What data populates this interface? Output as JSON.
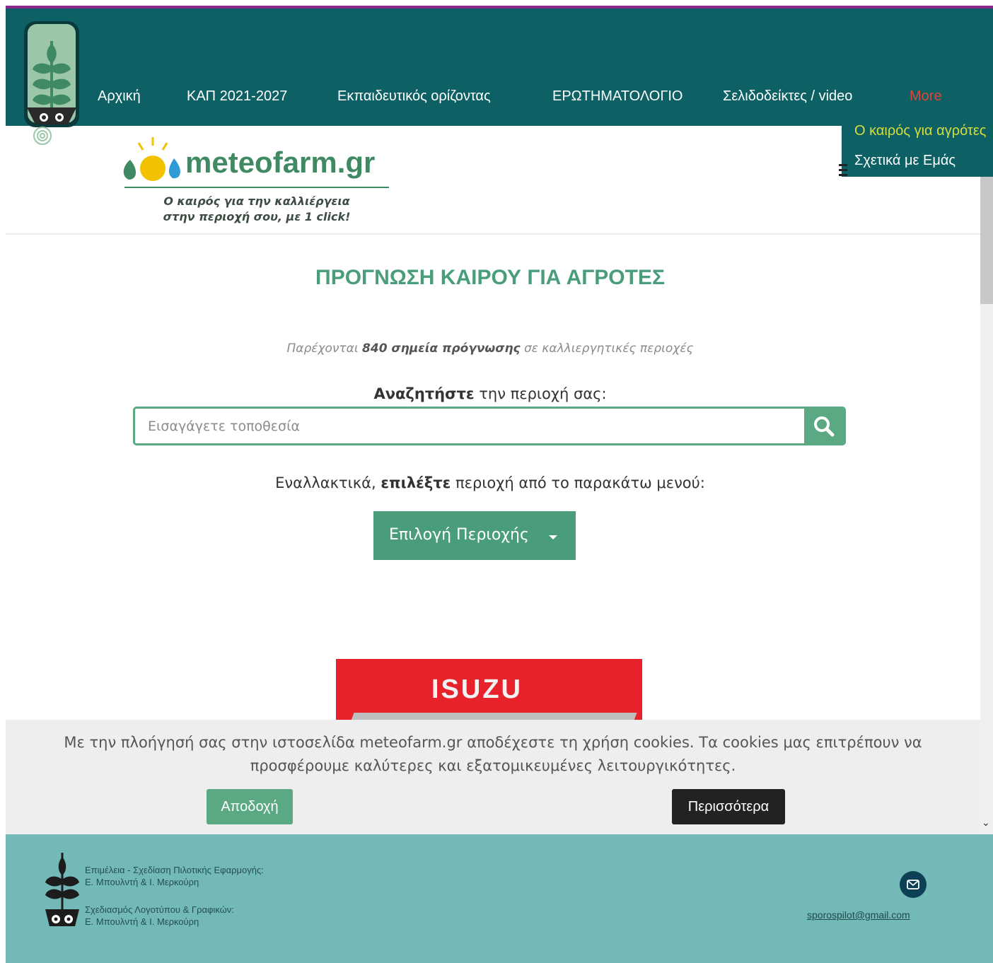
{
  "nav": {
    "items": [
      {
        "label": "Αρχική"
      },
      {
        "label": "ΚΑΠ 2021-2027"
      },
      {
        "label": "Εκπαιδευτικός ορίζοντας"
      },
      {
        "label": "ΕΡΩΤΗΜΑΤΟΛΟΓΙΟ"
      },
      {
        "label": "Σελιδοδείκτες / video"
      }
    ],
    "more_label": "More",
    "dropdown": [
      {
        "label": "Ο καιρός για αγρότες"
      },
      {
        "label": "Σχετικά με Εμάς"
      }
    ]
  },
  "logo": {
    "text": "meteofarm.gr",
    "tagline_line1": "Ο καιρός για την καλλιέργεια",
    "tagline_line2": "στην περιοχή σου, με 1 click!"
  },
  "main": {
    "title": "ΠΡΟΓΝΩΣΗ ΚΑΙΡΟΥ ΓΙΑ ΑΓΡΟΤΕΣ",
    "subtitle_pre": "Παρέχονται ",
    "subtitle_bold": "840 σημεία πρόγνωσης",
    "subtitle_post": " σε καλλιεργητικές περιοχές",
    "search_label_bold": "Αναζητήστε",
    "search_label_rest": " την περιοχή σας:",
    "search_placeholder": "Εισαγάγετε τοποθεσία",
    "alt_pre": "Εναλλακτικά, ",
    "alt_bold": "επιλέξτε",
    "alt_post": " περιοχή από το παρακάτω μενού:",
    "region_button": "Επιλογή Περιοχής"
  },
  "ad": {
    "brand": "ISUZU"
  },
  "cookie": {
    "text": "Με την πλοήγησή σας στην ιστοσελίδα meteofarm.gr αποδέχεστε τη χρήση cookies. Τα cookies μας επιτρέπουν να προσφέρουμε καλύτερες και εξατομικευμένες λειτουργικότητες.",
    "accept": "Αποδοχή",
    "more": "Περισσότερα"
  },
  "footer": {
    "credit1_title": "Επιμέλεια - Σχεδίαση Πιλοτικής Εφαρμογής:",
    "credit1_names": "Ε. Μπουλντή & Ι. Μερκούρη",
    "credit2_title": "Σχεδιασμός Λογοτύπου & Γραφικών:",
    "credit2_names": "Ε. Μπουλντή & Ι. Μερκούρη",
    "email": "sporospilot@gmail.com"
  },
  "colors": {
    "nav_bg": "#0d6165",
    "accent_green": "#4a9d7a",
    "footer_bg": "#72b9b7",
    "more_red": "#e0443a",
    "dropdown_active": "#d9dc3a"
  }
}
